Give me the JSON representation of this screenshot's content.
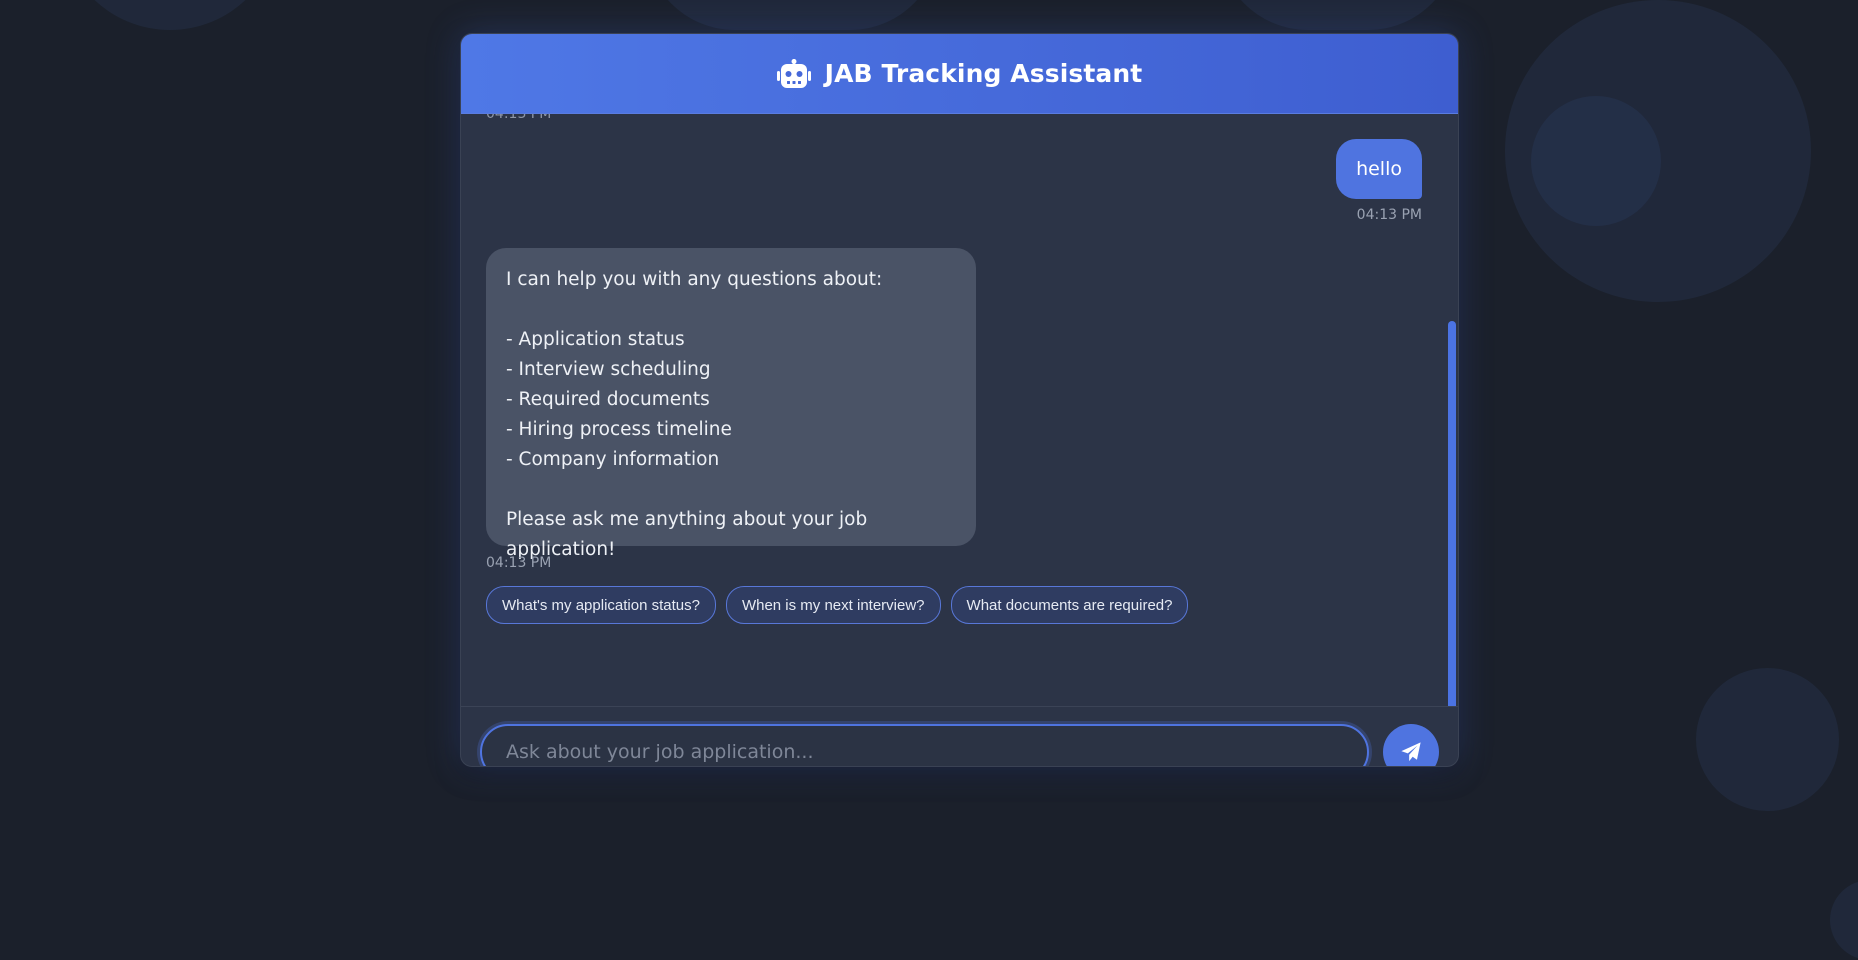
{
  "header": {
    "title": "JAB Tracking Assistant",
    "icon": "robot-icon"
  },
  "messages": {
    "cut_timestamp": "04:13 PM",
    "user_message": {
      "text": "hello",
      "time": "04:13 PM"
    },
    "bot_message": {
      "text": "I can help you with any questions about:\n\n- Application status\n- Interview scheduling\n- Required documents\n- Hiring process timeline\n- Company information\n\nPlease ask me anything about your job application!",
      "time": "04:13 PM"
    },
    "quick_replies": [
      "What's my application status?",
      "When is my next interview?",
      "What documents are required?"
    ]
  },
  "input": {
    "placeholder": "Ask about your job application...",
    "value": ""
  },
  "send_button": {
    "icon": "paper-plane-icon"
  },
  "colors": {
    "accent": "#4f74e0",
    "page_background": "#1b202b",
    "window_background": "#2c3447",
    "bot_bubble": "#4a5366"
  }
}
